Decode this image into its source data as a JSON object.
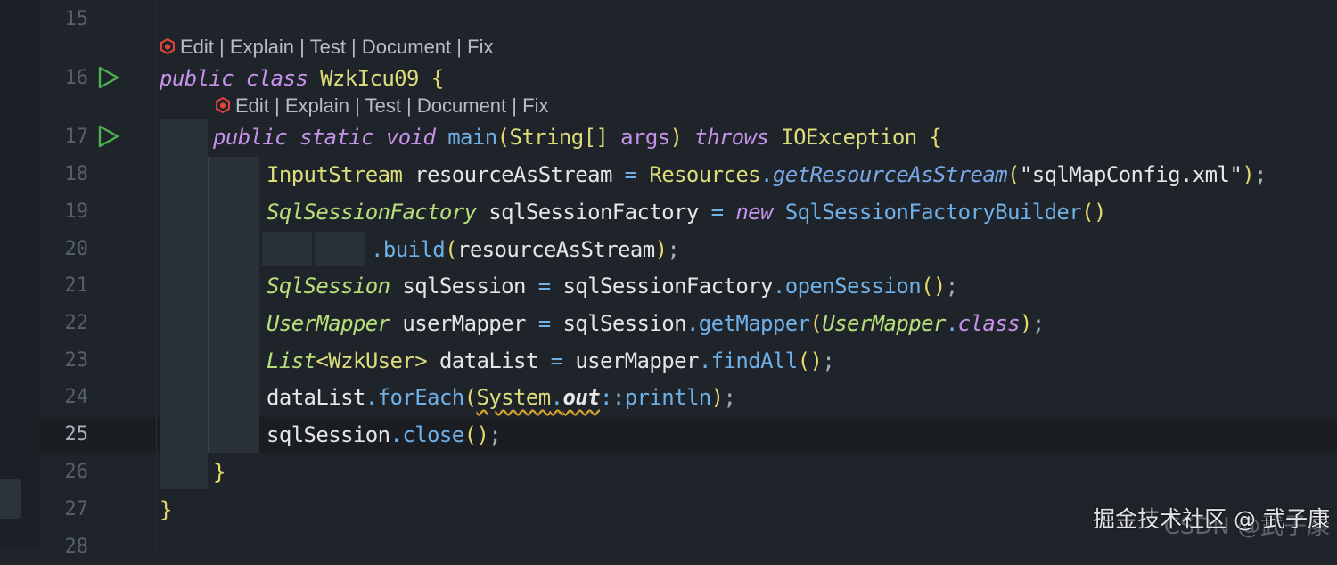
{
  "line_numbers": [
    "15",
    "16",
    "17",
    "18",
    "19",
    "20",
    "21",
    "22",
    "23",
    "24",
    "25",
    "26",
    "27",
    "28"
  ],
  "current_line_number": "25",
  "codelens": {
    "items": [
      "Edit",
      "Explain",
      "Test",
      "Document",
      "Fix"
    ],
    "separator": " | "
  },
  "code": {
    "l16": {
      "kw1": "public",
      "kw2": "class",
      "name": "WzkIcu09",
      "brace": "{"
    },
    "l17": {
      "kw1": "public",
      "kw2": "static",
      "kw3": "void",
      "method": "main",
      "p1": "(",
      "type": "String[]",
      "param": "args",
      "p2": ")",
      "kw4": "throws",
      "exc": "IOException",
      "brace": "{"
    },
    "l18": {
      "type": "InputStream",
      "var": "resourceAsStream",
      "eq": "=",
      "cls": "Resources",
      "dot": ".",
      "method": "getResourceAsStream",
      "p1": "(",
      "str": "\"sqlMapConfig.xml\"",
      "p2": ")",
      "semi": ";"
    },
    "l19": {
      "type": "SqlSessionFactory",
      "var": "sqlSessionFactory",
      "eq": "=",
      "kw": "new",
      "cls": "SqlSessionFactoryBuilder",
      "parens": "()"
    },
    "l20": {
      "dot": ".",
      "method": "build",
      "p1": "(",
      "arg": "resourceAsStream",
      "p2": ")",
      "semi": ";"
    },
    "l21": {
      "type": "SqlSession",
      "var": "sqlSession",
      "eq": "=",
      "obj": "sqlSessionFactory",
      "dot": ".",
      "method": "openSession",
      "parens": "()",
      "semi": ";"
    },
    "l22": {
      "type": "UserMapper",
      "var": "userMapper",
      "eq": "=",
      "obj": "sqlSession",
      "dot": ".",
      "method": "getMapper",
      "p1": "(",
      "arg": "UserMapper",
      "dot2": ".",
      "kw": "class",
      "p2": ")",
      "semi": ";"
    },
    "l23": {
      "type": "List",
      "lt": "<",
      "generic": "WzkUser",
      "gt": ">",
      "var": "dataList",
      "eq": "=",
      "obj": "userMapper",
      "dot": ".",
      "method": "findAll",
      "parens": "()",
      "semi": ";"
    },
    "l24": {
      "obj": "dataList",
      "dot": ".",
      "method": "forEach",
      "p1": "(",
      "cls": "System",
      "dot2": ".",
      "field": "out",
      "sep": "::",
      "ref": "println",
      "p2": ")",
      "semi": ";"
    },
    "l25": {
      "obj": "sqlSession",
      "dot": ".",
      "method": "close",
      "parens": "()",
      "semi": ";"
    },
    "l26": {
      "brace": "}"
    },
    "l27": {
      "brace": "}"
    }
  },
  "watermark": {
    "text": "掘金技术社区 @ 武子康",
    "ghost": "CSDN @武子康"
  },
  "colors": {
    "background": "#1f242b",
    "keyword": "#c792ea",
    "class": "#dcdc7a",
    "method": "#6fb0e6",
    "run_icon": "#4caf50",
    "lens_icon": "#e0443a"
  },
  "icons": {
    "run": "run-triangle-icon",
    "lens": "ai-assistant-icon"
  }
}
